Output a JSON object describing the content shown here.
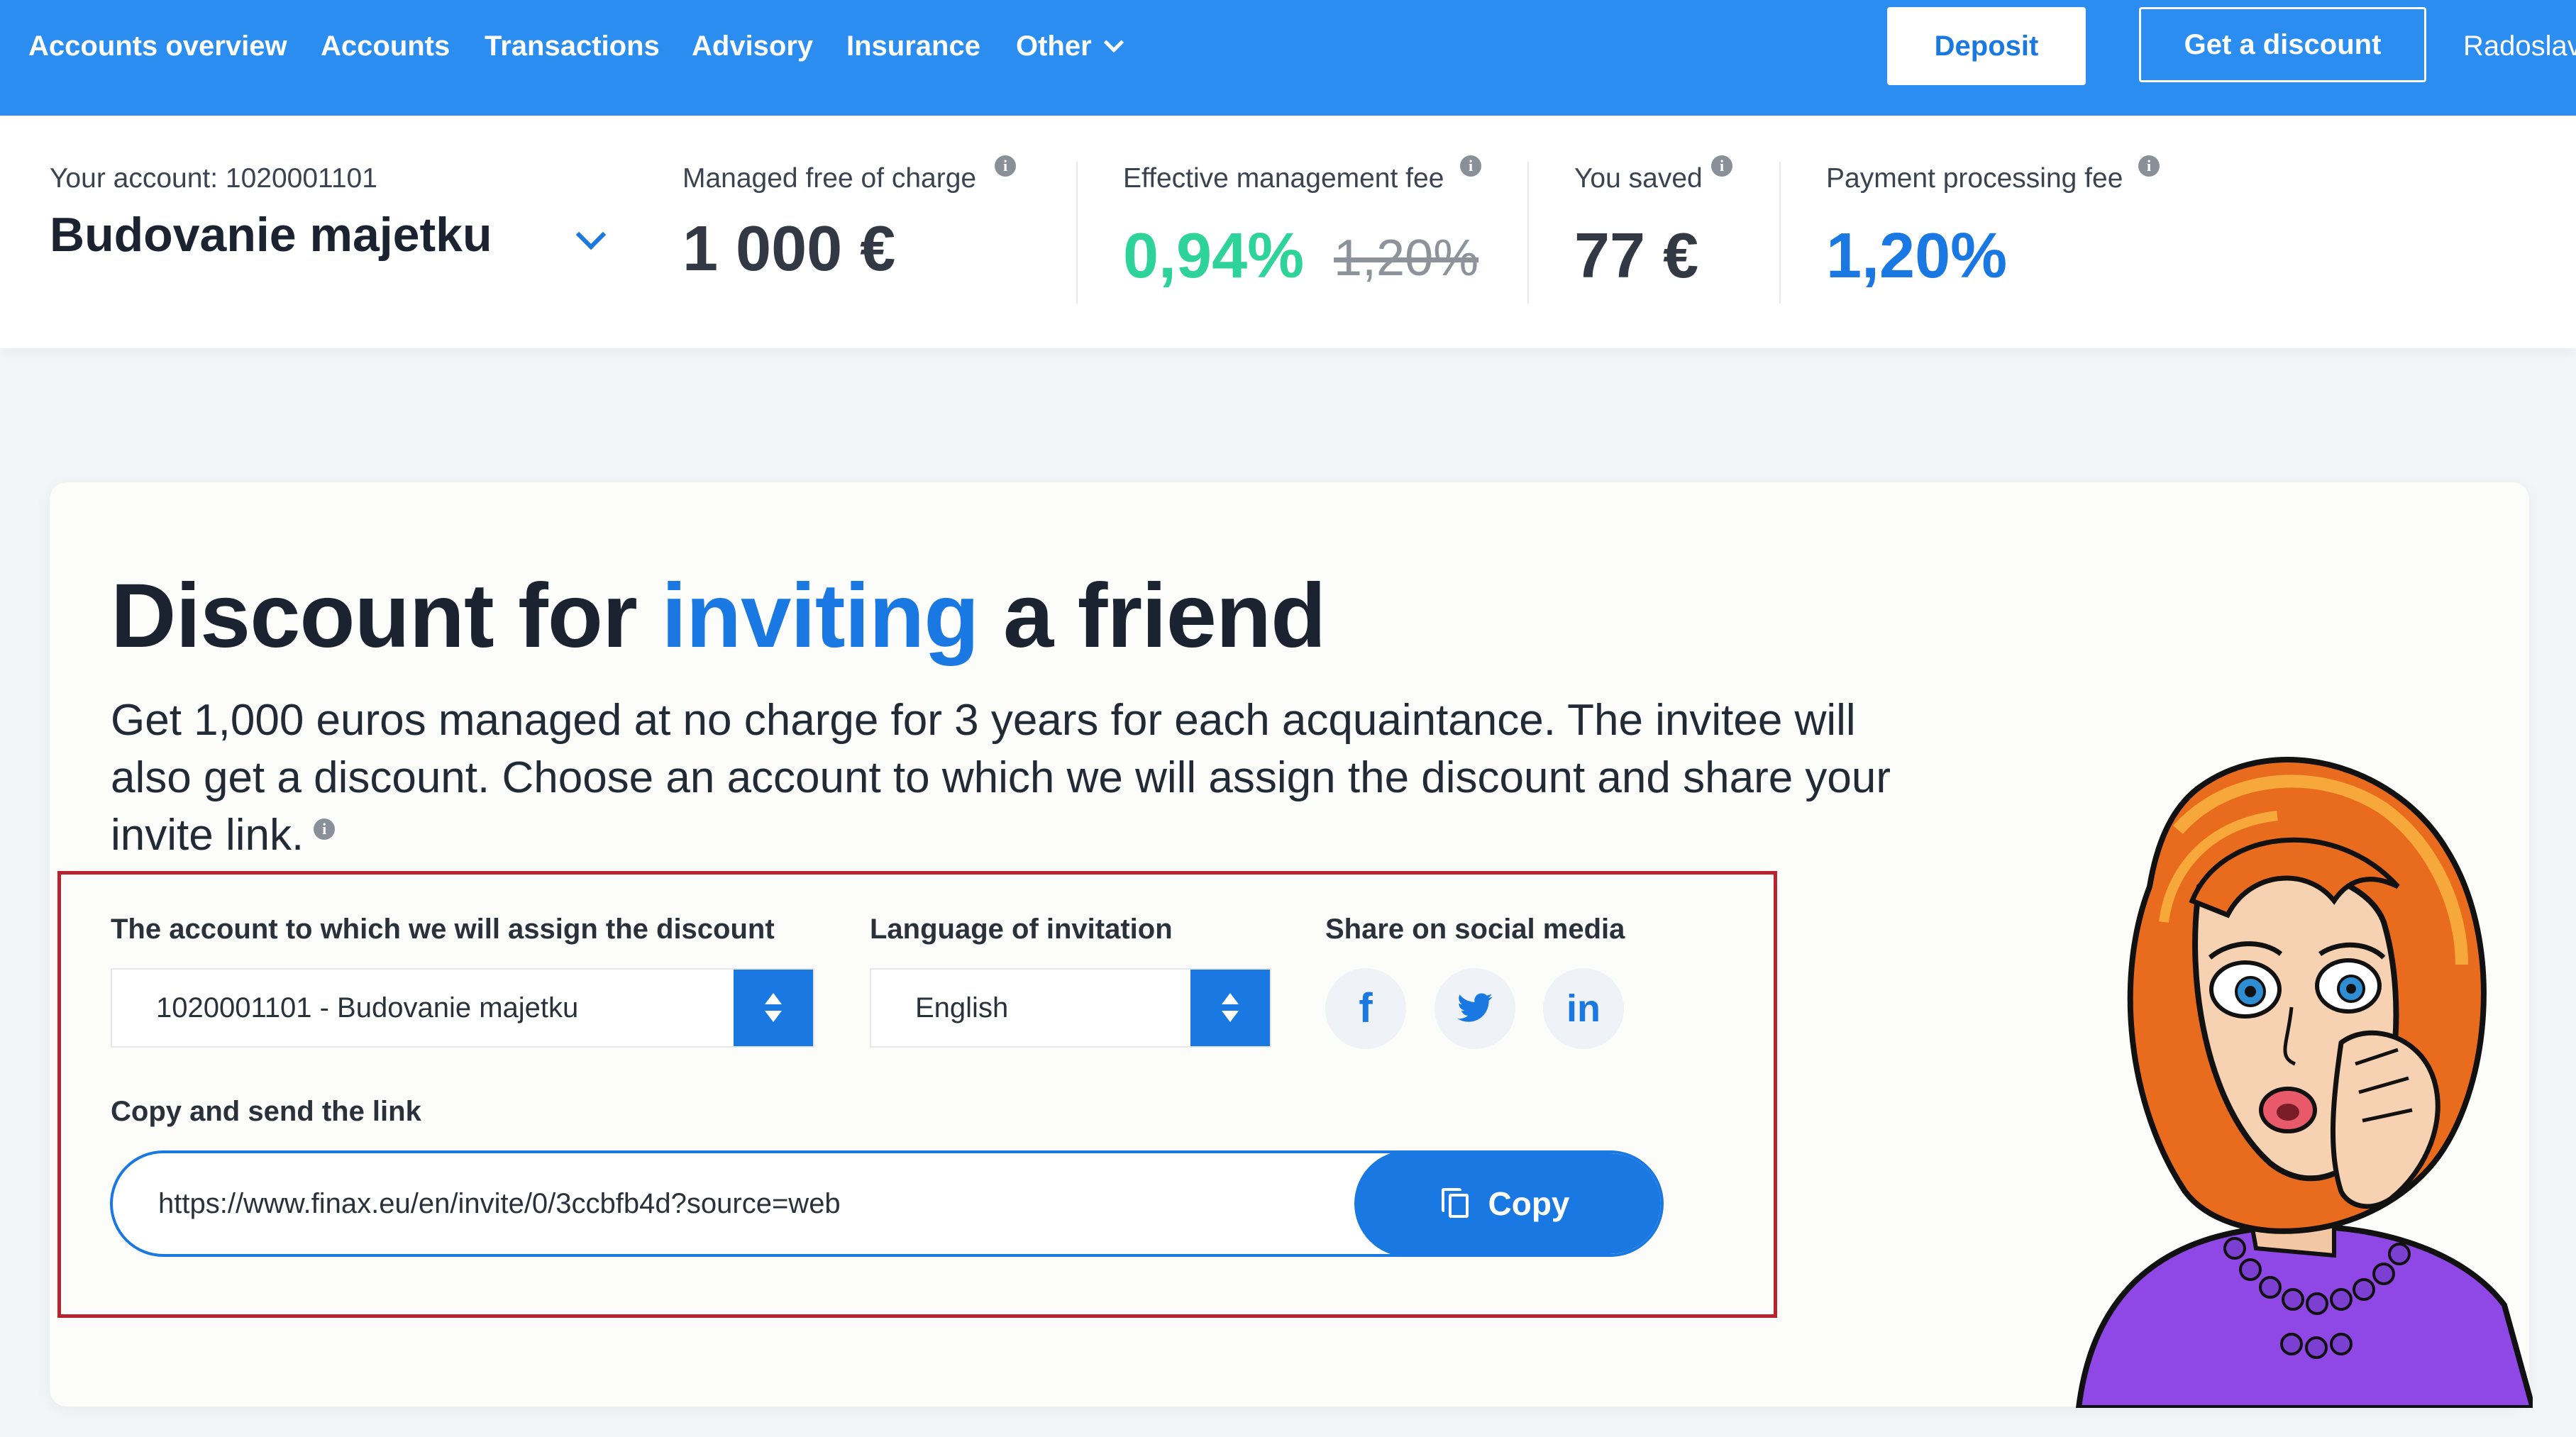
{
  "nav": {
    "items": [
      "Accounts overview",
      "Accounts",
      "Transactions",
      "Advisory",
      "Insurance",
      "Other"
    ],
    "deposit_label": "Deposit",
    "discount_label": "Get a discount",
    "user_name": "Radoslav"
  },
  "account": {
    "label": "Your account: 1020001101",
    "name": "Budovanie majetku"
  },
  "stats": [
    {
      "label": "Managed free of charge",
      "value": "1 000 €"
    },
    {
      "label": "Effective management fee",
      "value": "0,94%",
      "old_value": "1,20%"
    },
    {
      "label": "You saved",
      "value": "77 €"
    },
    {
      "label": "Payment processing fee",
      "value": "1,20%"
    }
  ],
  "card": {
    "title_part1": "Discount for ",
    "title_highlight": "inviting",
    "title_part2": " a friend",
    "description": "Get 1,000 euros managed at no charge for 3 years for each acquaintance. The invitee will also get a discount. Choose an account to which we will assign the discount and share your invite link."
  },
  "form": {
    "account_label": "The account to which we will assign the discount",
    "account_value": "1020001101 - Budovanie majetku",
    "language_label": "Language of invitation",
    "language_value": "English",
    "share_label": "Share on social media",
    "link_label": "Copy and send the link",
    "link_value": "https://www.finax.eu/en/invite/0/3ccbfb4d?source=web",
    "copy_label": "Copy"
  },
  "icons": {
    "info": "info-icon",
    "facebook": "facebook-icon",
    "twitter": "twitter-icon",
    "linkedin": "linkedin-icon",
    "copy": "copy-icon"
  },
  "colors": {
    "nav_bg": "#2b8df0",
    "accent": "#1a78e2",
    "green": "#2ed39a",
    "highlight_border": "#b8232d"
  }
}
